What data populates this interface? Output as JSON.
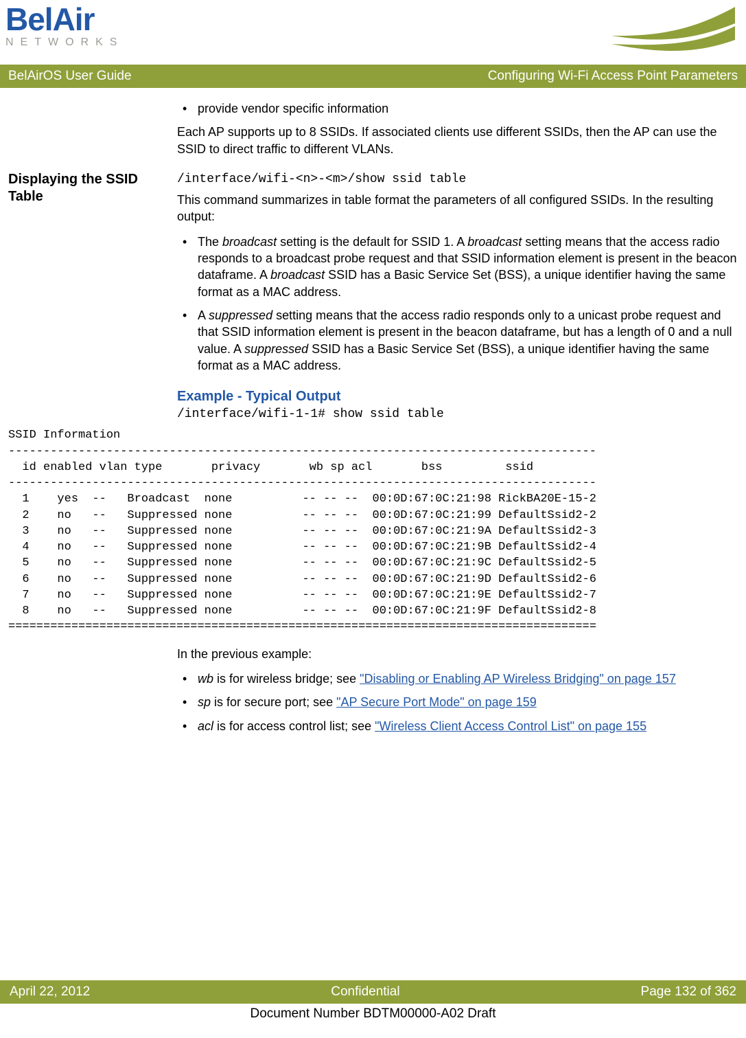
{
  "logo": {
    "top": "BelAir",
    "bottom": "NETWORKS"
  },
  "banner": {
    "left": "BelAirOS User Guide",
    "right": "Configuring Wi-Fi Access Point Parameters"
  },
  "intro": {
    "bullet1": "provide vendor specific information",
    "para": "Each AP supports up to 8 SSIDs. If associated clients use different SSIDs, then the AP can use the SSID to direct traffic to different VLANs."
  },
  "sectionHeading": "Displaying the SSID Table",
  "cmd": {
    "p1": "/interface/wifi-<n>-<m>/",
    "p2": "show ssid table"
  },
  "desc": "This command summarizes in table format the parameters of all configured SSIDs. In the resulting output:",
  "b1": {
    "t1": "The ",
    "i1": "broadcast",
    "t2": " setting is the default for SSID 1. A ",
    "i2": "broadcast",
    "t3": " setting means that the access radio responds to a broadcast probe request and that SSID information element is present in the beacon dataframe. A ",
    "i3": "broadcast",
    "t4": " SSID has a Basic Service Set (BSS), a unique identifier having the same format as a MAC address."
  },
  "b2": {
    "t1": "A ",
    "i1": "suppressed",
    "t2": " setting means that the access radio responds only to a unicast probe request and that SSID information element is present in the beacon dataframe, but has a length of 0 and a null value. A ",
    "i2": "suppressed",
    "t3": " SSID has a Basic Service Set (BSS), a unique identifier having the same format as a MAC address."
  },
  "exampleHeading": "Example - Typical Output",
  "exampleCmd": "/interface/wifi-1-1# show ssid table",
  "table": {
    "title": "SSID Information",
    "sep": "------------------------------------------------------------------------------------",
    "header": "  id enabled vlan type       privacy       wb sp acl       bss         ssid",
    "rows": [
      "  1    yes  --   Broadcast  none          -- -- --  00:0D:67:0C:21:98 RickBA20E-15-2",
      "  2    no   --   Suppressed none          -- -- --  00:0D:67:0C:21:99 DefaultSsid2-2",
      "  3    no   --   Suppressed none          -- -- --  00:0D:67:0C:21:9A DefaultSsid2-3",
      "  4    no   --   Suppressed none          -- -- --  00:0D:67:0C:21:9B DefaultSsid2-4",
      "  5    no   --   Suppressed none          -- -- --  00:0D:67:0C:21:9C DefaultSsid2-5",
      "  6    no   --   Suppressed none          -- -- --  00:0D:67:0C:21:9D DefaultSsid2-6",
      "  7    no   --   Suppressed none          -- -- --  00:0D:67:0C:21:9E DefaultSsid2-7",
      "  8    no   --   Suppressed none          -- -- --  00:0D:67:0C:21:9F DefaultSsid2-8"
    ],
    "end": "===================================================================================="
  },
  "post": "In the previous example:",
  "defs": {
    "wb": {
      "term": "wb",
      "t1": " is for wireless bridge; see ",
      "link": "\"Disabling or Enabling AP Wireless Bridging\" on page 157"
    },
    "sp": {
      "term": "sp",
      "t1": " is for secure port; see ",
      "link": "\"AP Secure Port Mode\" on page 159"
    },
    "acl": {
      "term": "acl",
      "t1": " is for access control list; see ",
      "link": "\"Wireless Client Access Control List\" on page 155"
    }
  },
  "footer": {
    "left": "April 22, 2012",
    "center": "Confidential",
    "right": "Page 132 of 362",
    "doc": "Document Number BDTM00000-A02 Draft"
  }
}
